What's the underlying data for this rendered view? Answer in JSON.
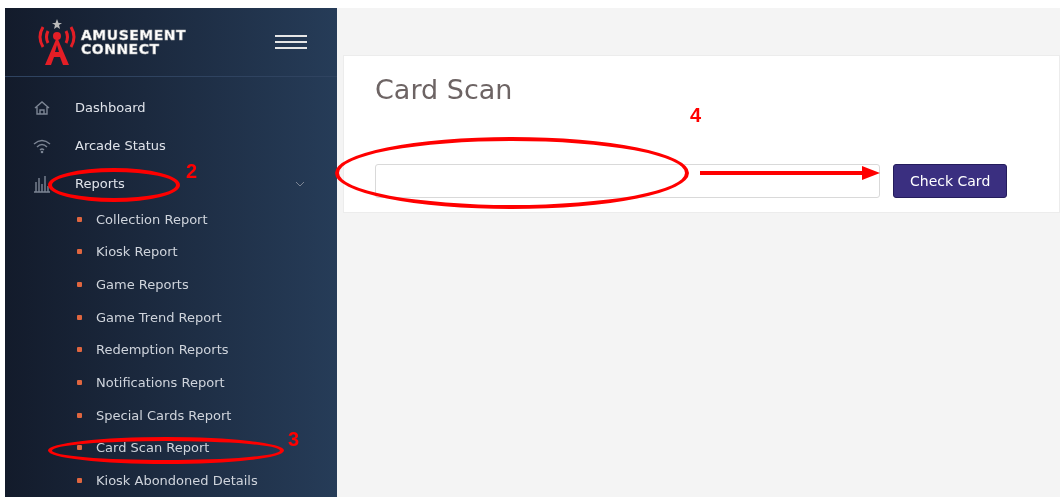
{
  "logo": {
    "line_1": "AMUSEMENT",
    "line_2": "CONNECT"
  },
  "sidebar": {
    "items": [
      {
        "label": "Dashboard",
        "kind": "home"
      },
      {
        "label": "Arcade Status",
        "kind": "wifi"
      },
      {
        "label": "Reports",
        "kind": "chart",
        "expanded": true,
        "children": [
          {
            "label": "Collection Report"
          },
          {
            "label": "Kiosk Report"
          },
          {
            "label": "Game Reports"
          },
          {
            "label": "Game Trend Report"
          },
          {
            "label": "Redemption Reports"
          },
          {
            "label": "Notifications Report"
          },
          {
            "label": "Special Cards Report"
          },
          {
            "label": "Card Scan Report"
          },
          {
            "label": "Kiosk Abondoned Details"
          }
        ]
      }
    ]
  },
  "card": {
    "title": "Card Scan",
    "button": "Check Card"
  },
  "annotations": [
    {
      "number": "2"
    },
    {
      "number": "3"
    },
    {
      "number": "4"
    }
  ]
}
